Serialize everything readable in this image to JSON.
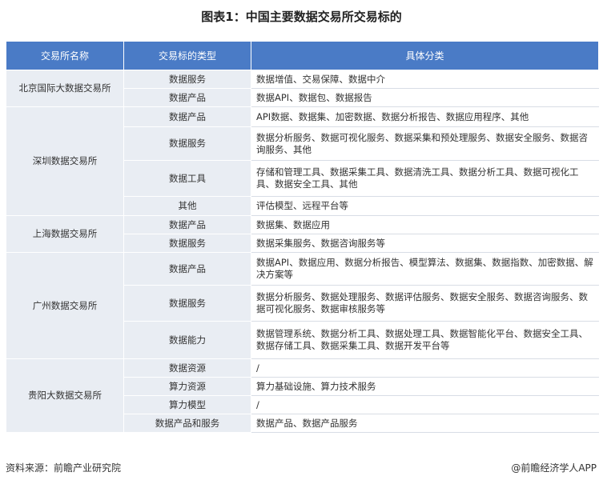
{
  "title": "图表1：中国主要数据交易所交易标的",
  "headers": [
    "交易所名称",
    "交易标的类型",
    "具体分类"
  ],
  "groups": [
    {
      "exchange": "北京国际大数据交易所",
      "rows": [
        {
          "type": "数据服务",
          "detail": "数据增值、交易保障、数据中介",
          "h": 23
        },
        {
          "type": "数据产品",
          "detail": "数据API、数据包、数据报告",
          "h": 23
        }
      ]
    },
    {
      "exchange": "深圳数据交易所",
      "rows": [
        {
          "type": "数据产品",
          "detail": "API数据、数据集、加密数据、数据分析报告、数据应用程序、其他",
          "h": 25
        },
        {
          "type": "数据服务",
          "detail": "数据分析服务、数据可视化服务、数据采集和预处理服务、数据安全服务、数据咨询服务、其他",
          "h": 42
        },
        {
          "type": "数据工具",
          "detail": "存储和管理工具、数据采集工具、数据清洗工具、数据分析工具、数据可视化工具、数据安全工具、其他",
          "h": 45
        },
        {
          "type": "其他",
          "detail": "评估模型、远程平台等",
          "h": 24
        }
      ]
    },
    {
      "exchange": "上海数据交易所",
      "rows": [
        {
          "type": "数据产品",
          "detail": "数据集、数据应用",
          "h": 23
        },
        {
          "type": "数据服务",
          "detail": "数据采集服务、数据咨询服务等",
          "h": 23
        }
      ]
    },
    {
      "exchange": "广州数据交易所",
      "rows": [
        {
          "type": "数据产品",
          "detail": "数据API、数据应用、数据分析报告、模型算法、数据集、数据指数、加密数据、解决方案等",
          "h": 41
        },
        {
          "type": "数据服务",
          "detail": "数据分析服务、数据处理服务、数据评估服务、数据安全服务、数据咨询服务、数据可视化服务、数据审核服务等",
          "h": 45
        },
        {
          "type": "数据能力",
          "detail": "数据管理系统、数据分析工具、数据处理工具、数据智能化平台、数据安全工具、数据存储工具、数据采集工具、数据开发平台等",
          "h": 47
        }
      ]
    },
    {
      "exchange": "贵阳大数据交易所",
      "rows": [
        {
          "type": "数据资源",
          "detail": "/",
          "h": 23
        },
        {
          "type": "算力资源",
          "detail": "算力基础设施、算力技术服务",
          "h": 23
        },
        {
          "type": "算力模型",
          "detail": "/",
          "h": 23
        },
        {
          "type": "数据产品和服务",
          "detail": "数据产品、数据产品服务",
          "h": 23
        }
      ]
    }
  ],
  "footer": {
    "source": "资料来源：前瞻产业研究院",
    "credit": "@前瞻经济学人APP"
  }
}
